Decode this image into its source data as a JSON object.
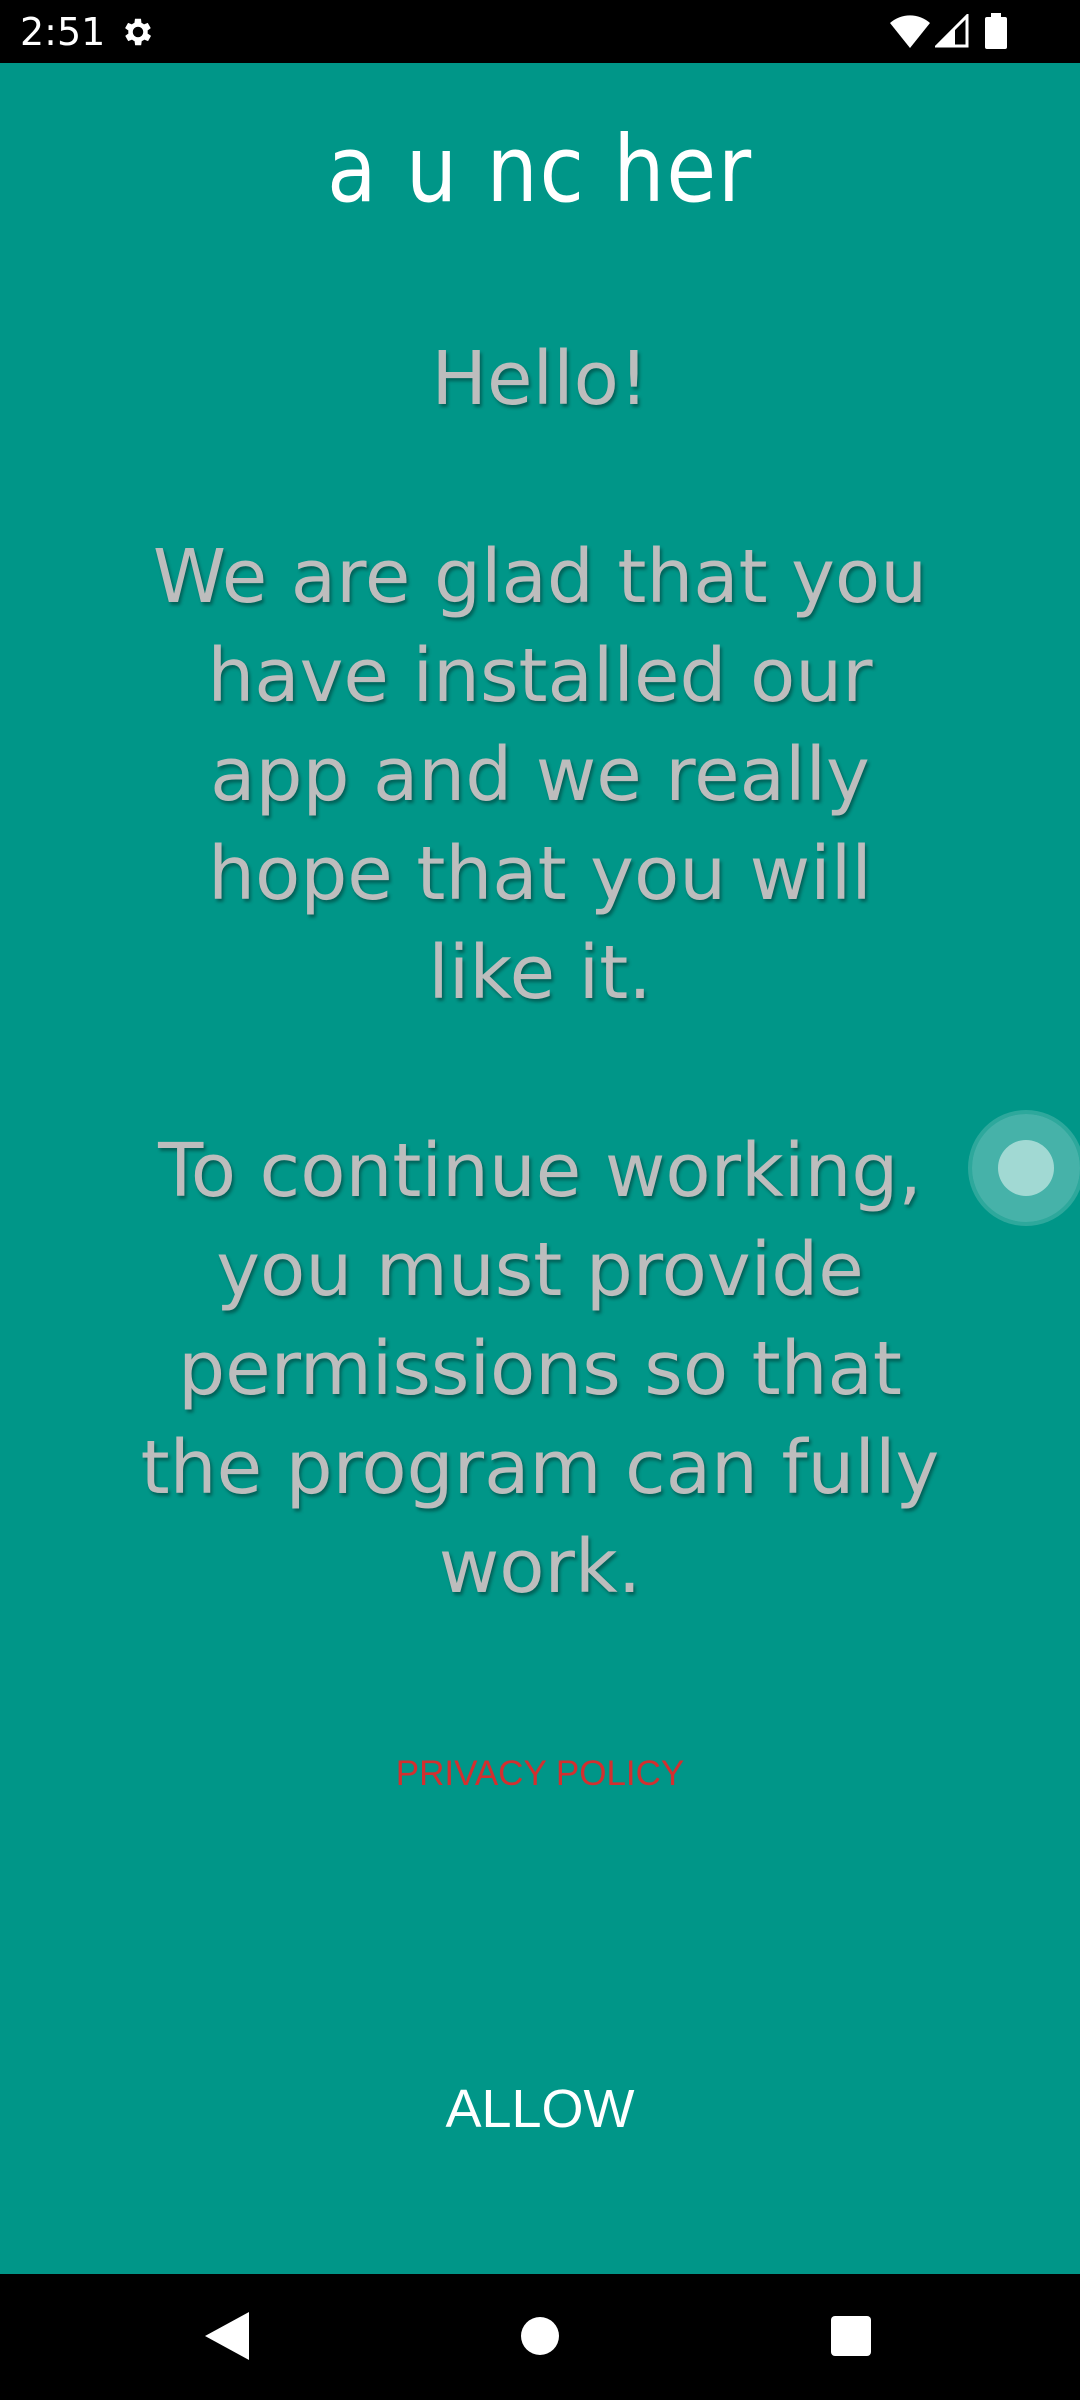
{
  "status_bar": {
    "time": "2:51",
    "icons": [
      "gear-icon",
      "wifi-icon",
      "signal-icon",
      "battery-icon"
    ]
  },
  "app": {
    "logo_text": "a u nc her"
  },
  "message": {
    "hello": "Hello!",
    "glad": "We are glad that you have installed our app and we really hope that you will like it.",
    "continue": "To continue working, you must provide permissions so that the program can fully work."
  },
  "links": {
    "privacy_policy": "PRIVACY POLICY"
  },
  "actions": {
    "allow_label": "ALLOW"
  },
  "nav_bar": {
    "icons": [
      "back-icon",
      "home-icon",
      "recents-icon"
    ]
  },
  "colors": {
    "background": "#009688",
    "message_text": "#bdbdbd",
    "privacy_link": "#d32f2f",
    "button_text": "#ffffff"
  }
}
